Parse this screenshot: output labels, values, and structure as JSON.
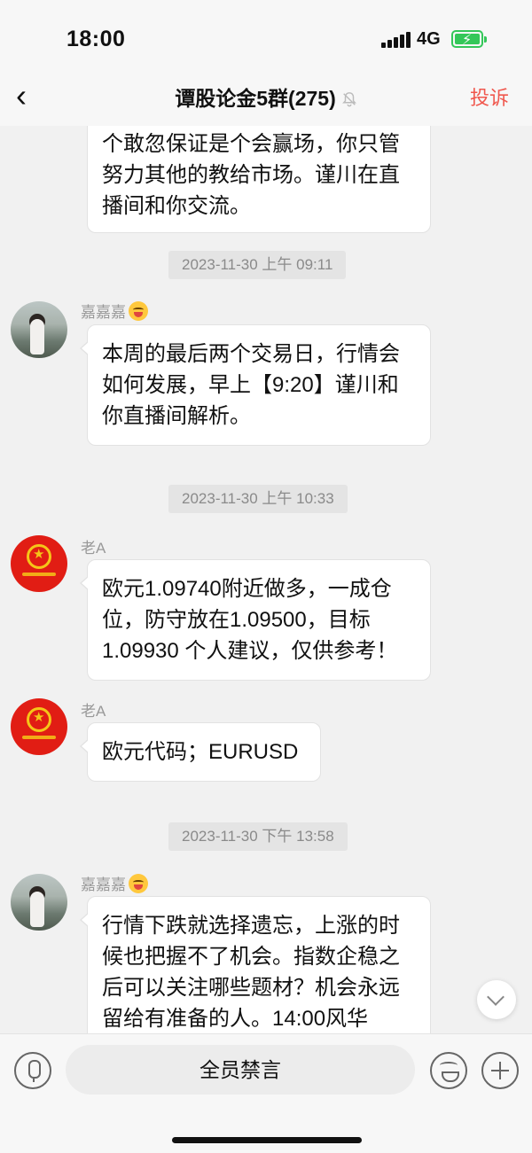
{
  "status_bar": {
    "time": "18:00",
    "network": "4G",
    "battery_icon": "battery-charging-icon",
    "signal_icon": "signal-dots-icon"
  },
  "nav": {
    "back_icon": "chevron-left-icon",
    "title": "谭股论金5群(275)",
    "bell_icon": "bell-muted-icon",
    "report_label": "投诉",
    "report_color": "#f0574d"
  },
  "messages": [
    {
      "type": "partial_bubble",
      "lines": [
        "个敢忽保证是个会赢场，你只管",
        "努力其他的教给市场。谨川在直",
        "播间和你交流。"
      ]
    },
    {
      "type": "timestamp",
      "text": "2023-11-30 上午 09:11"
    },
    {
      "type": "message",
      "sender": "嘉嘉嘉",
      "sender_emoji": "yum-face-emoji",
      "avatar": "woman-photo-avatar",
      "lines": [
        "本周的最后两个交易日，行情会",
        "如何发展，早上【9:20】谨川和",
        "你直播间解析。"
      ]
    },
    {
      "type": "timestamp",
      "text": "2023-11-30 上午 10:33"
    },
    {
      "type": "message",
      "sender": "老A",
      "avatar": "national-emblem-avatar",
      "lines": [
        "欧元1.09740附近做多，一成仓",
        "位，防守放在1.09500，目标",
        "1.09930 个人建议，仅供参考！"
      ]
    },
    {
      "type": "message",
      "sender": "老A",
      "avatar": "national-emblem-avatar",
      "lines": [
        "欧元代码；EURUSD"
      ]
    },
    {
      "type": "timestamp",
      "text": "2023-11-30 下午 13:58"
    },
    {
      "type": "message",
      "sender": "嘉嘉嘉",
      "sender_emoji": "yum-face-emoji",
      "avatar": "woman-photo-avatar",
      "lines": [
        "行情下跌就选择遗忘，上涨的时",
        "候也把握不了机会。指数企稳之",
        "后可以关注哪些题材？机会永远",
        "留给有准备的人。14:00风华"
      ]
    }
  ],
  "input_bar": {
    "mic_icon": "microphone-icon",
    "muted_text": "全员禁言",
    "emoji_icon": "smiley-icon",
    "plus_icon": "plus-icon"
  },
  "scroll_icon": "chevron-down-icon"
}
